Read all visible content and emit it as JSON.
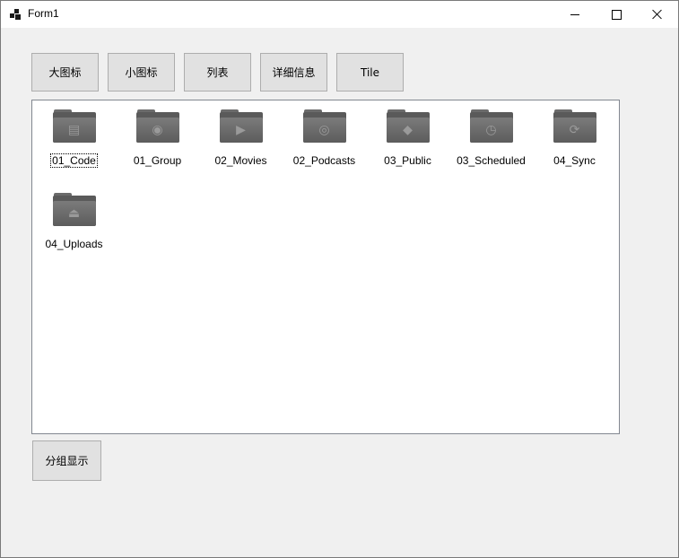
{
  "window": {
    "title": "Form1"
  },
  "toolbar": {
    "buttons": [
      {
        "label": "大图标"
      },
      {
        "label": "小图标"
      },
      {
        "label": "列表"
      },
      {
        "label": "详细信息"
      },
      {
        "label": "Tile"
      }
    ]
  },
  "listview": {
    "items": [
      {
        "label": "01_Code",
        "icon": "code-folder-icon",
        "glyph": "▤",
        "focused": true
      },
      {
        "label": "01_Group",
        "icon": "group-folder-icon",
        "glyph": "◉"
      },
      {
        "label": "02_Movies",
        "icon": "movies-folder-icon",
        "glyph": "▶"
      },
      {
        "label": "02_Podcasts",
        "icon": "podcasts-folder-icon",
        "glyph": "◎"
      },
      {
        "label": "03_Public",
        "icon": "public-folder-icon",
        "glyph": "◆"
      },
      {
        "label": "03_Scheduled",
        "icon": "scheduled-folder-icon",
        "glyph": "◷"
      },
      {
        "label": "04_Sync",
        "icon": "sync-folder-icon",
        "glyph": "⟳"
      },
      {
        "label": "04_Uploads",
        "icon": "uploads-folder-icon",
        "glyph": "⏏"
      }
    ]
  },
  "footer": {
    "group_label": "分组显示"
  }
}
